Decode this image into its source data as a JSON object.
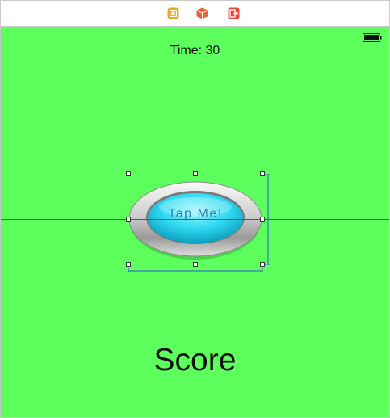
{
  "scene_dock": {
    "icons": [
      "view-controller-icon",
      "first-responder-icon",
      "exit-icon"
    ],
    "colors": {
      "view_controller": "#f0a21b",
      "first_responder": "#e5653a",
      "exit": "#e0483a"
    }
  },
  "canvas": {
    "background": "#5cff5c",
    "guide_color": "#2d57d8"
  },
  "labels": {
    "timer": "Time: 30",
    "score": "Score"
  },
  "button": {
    "title": "Tap Me!"
  }
}
